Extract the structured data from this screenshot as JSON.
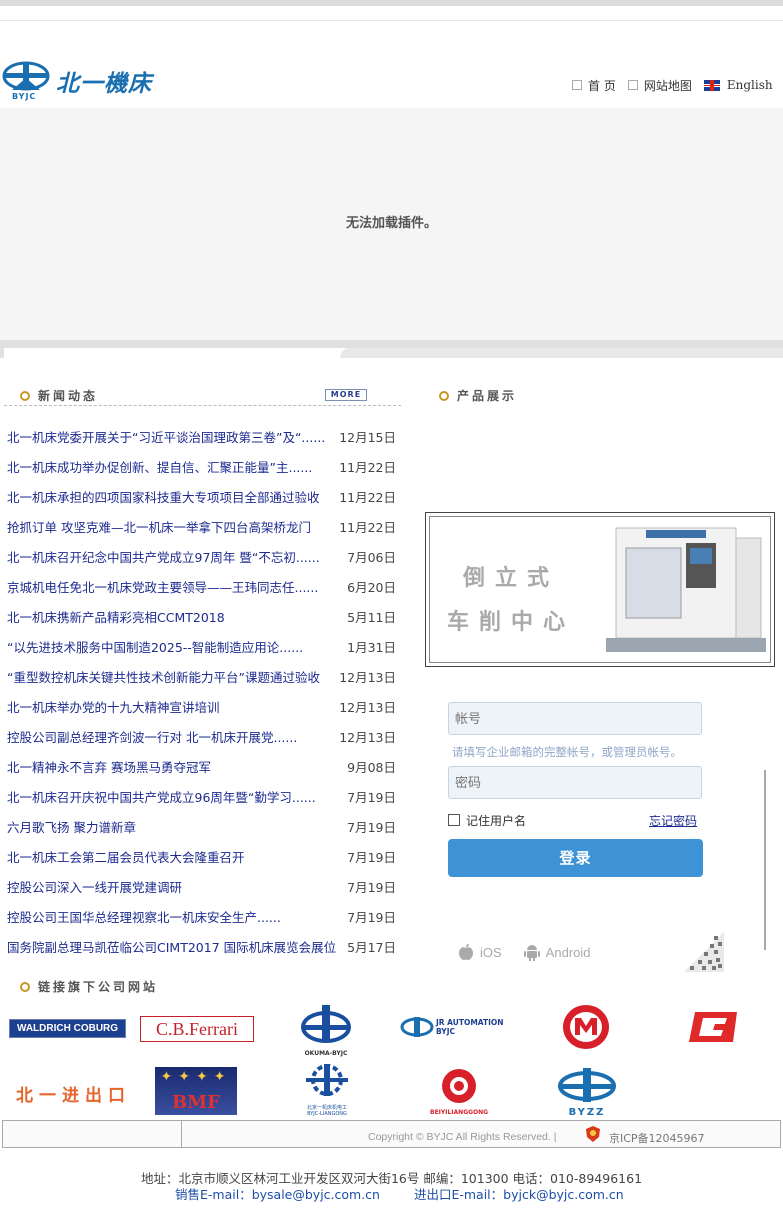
{
  "header": {
    "logo_text": "北一機床",
    "logo_sub": "BYJC",
    "links": [
      {
        "label": "首 页"
      },
      {
        "label": "网站地图"
      },
      {
        "label": "English"
      }
    ]
  },
  "banner": {
    "plugin_message": "无法加载插件。"
  },
  "news": {
    "title": "新闻动态",
    "more_label": "MORE",
    "items": [
      {
        "title": "北一机床党委开展关于“习近平谈治国理政第三卷”及“......",
        "date": "12月15日"
      },
      {
        "title": "北一机床成功举办促创新、提自信、汇聚正能量”主......",
        "date": "11月22日"
      },
      {
        "title": "北一机床承担的四项国家科技重大专项项目全部通过验收",
        "date": "11月22日"
      },
      {
        "title": "抢抓订单 攻坚克难—北一机床一举拿下四台高架桥龙门",
        "date": "11月22日"
      },
      {
        "title": "北一机床召开纪念中国共产党成立97周年 暨“不忘初......",
        "date": "7月06日"
      },
      {
        "title": "京城机电任免北一机床党政主要领导——王玮同志任......",
        "date": "6月20日"
      },
      {
        "title": "北一机床携新产品精彩亮相CCMT2018",
        "date": "5月11日"
      },
      {
        "title": "“以先进技术服务中国制造2025--智能制造应用论......",
        "date": "1月31日"
      },
      {
        "title": "“重型数控机床关键共性技术创新能力平台”课题通过验收",
        "date": "12月13日"
      },
      {
        "title": "北一机床举办党的十九大精神宣讲培训",
        "date": "12月13日"
      },
      {
        "title": "控股公司副总经理齐剑波一行对 北一机床开展党......",
        "date": "12月13日"
      },
      {
        "title": "北一精神永不言弃 赛场黑马勇夺冠军",
        "date": "9月08日"
      },
      {
        "title": "北一机床召开庆祝中国共产党成立96周年暨“勤学习......",
        "date": "7月19日"
      },
      {
        "title": "六月歌飞扬 聚力谱新章",
        "date": "7月19日"
      },
      {
        "title": "北一机床工会第二届会员代表大会隆重召开",
        "date": "7月19日"
      },
      {
        "title": "控股公司深入一线开展党建调研",
        "date": "7月19日"
      },
      {
        "title": "控股公司王国华总经理视察北一机床安全生产......",
        "date": "7月19日"
      },
      {
        "title": "国务院副总理马凯莅临公司CIMT2017 国际机床展览会展位",
        "date": "5月17日"
      }
    ]
  },
  "products": {
    "title": "产品展示",
    "banner_line1": "倒立式",
    "banner_line2": "车削中心"
  },
  "login": {
    "account_placeholder": "帐号",
    "account_hint": "请填写企业邮箱的完整帐号，或管理员帐号。",
    "password_placeholder": "密码",
    "remember_label": "记住用户名",
    "forgot_label": "忘记密码",
    "login_button": "登录",
    "apps": [
      {
        "label": "iOS"
      },
      {
        "label": "Android"
      }
    ]
  },
  "subsidiaries": {
    "title": "链接旗下公司网站",
    "logos": [
      {
        "name": "WALDRICH COBURG"
      },
      {
        "name": "C.B.Ferrari"
      },
      {
        "name": "OKUMA-BYJC"
      },
      {
        "name": "JR AUTOMATION BYJC"
      },
      {
        "name": "m-logo"
      },
      {
        "name": "B-logo"
      },
      {
        "name": "北一进出口"
      },
      {
        "name": "BMF"
      },
      {
        "name": "北京一机床机电工 BYJC-LIANGONG"
      },
      {
        "name": "BEIYILIANGGONG"
      },
      {
        "name": "BYZZ"
      }
    ]
  },
  "footer": {
    "copyright": "Copyright © BYJC All Rights Reserved. |",
    "icp": "京ICP备12045967",
    "address": "地址：北京市顺义区林河工业开发区双河大街16号   邮编：101300    电话：010-89496161",
    "sales_email": "销售E-mail：bysale@byjc.com.cn",
    "export_email": "进出口E-mail：byjck@byjc.com.cn"
  },
  "colors": {
    "accent": "#3d93d6",
    "link": "#1d2b8f",
    "bullet": "#c8962a"
  }
}
